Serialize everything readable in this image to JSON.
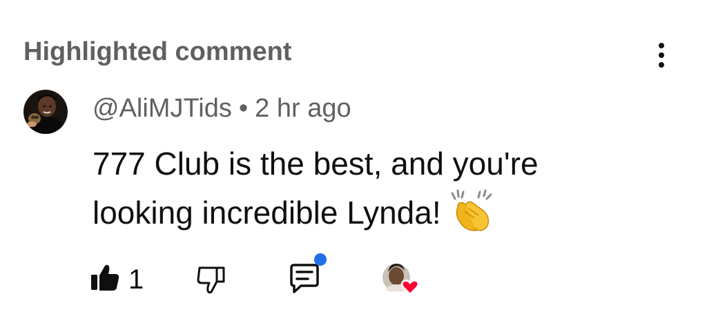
{
  "header": {
    "title": "Highlighted comment",
    "more_icon": "more-vert-icon"
  },
  "comment": {
    "author": "@AliMJTids",
    "separator": "•",
    "time": "2 hr ago",
    "text_line1": "777 Club is the best, and you're",
    "text_line2": "looking incredible Lynda!",
    "emoji_icon": "clapping-hands-icon",
    "likes": "1"
  },
  "icons": {
    "like": "thumbs-up-filled-icon",
    "dislike": "thumbs-down-icon",
    "reply": "reply-comment-icon",
    "heart": "creator-heart-icon"
  },
  "colors": {
    "text_primary": "#0f0f0f",
    "text_secondary": "#606060",
    "notification_dot": "#1f6fe5",
    "heart": "#ff0033"
  }
}
